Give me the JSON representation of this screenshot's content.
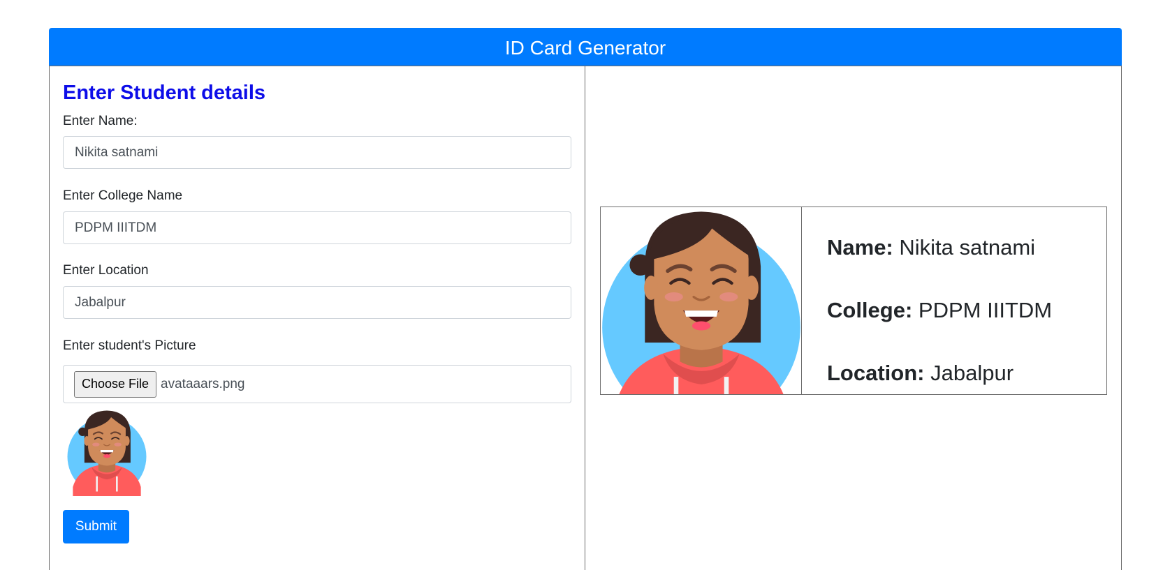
{
  "header": {
    "title": "ID Card Generator"
  },
  "form": {
    "title": "Enter Student details",
    "name_label": "Enter Name:",
    "name_value": "Nikita satnami",
    "college_label": "Enter College Name",
    "college_value": "PDPM IIITDM",
    "location_label": "Enter Location",
    "location_value": "Jabalpur",
    "picture_label": "Enter student's Picture",
    "file_button_label": "Choose File",
    "file_name": "avataaars.png",
    "submit_label": "Submit"
  },
  "card": {
    "name_label": "Name:",
    "name_value": "Nikita satnami",
    "college_label": "College:",
    "college_value": "PDPM IIITDM",
    "location_label": "Location:",
    "location_value": "Jabalpur"
  },
  "colors": {
    "primary": "#007bff",
    "title_blue": "#0d0de8",
    "avatar_bg": "#65c9ff",
    "skin": "#d08b5b",
    "hair": "#3b2622",
    "hoodie": "#ff5c5c"
  }
}
